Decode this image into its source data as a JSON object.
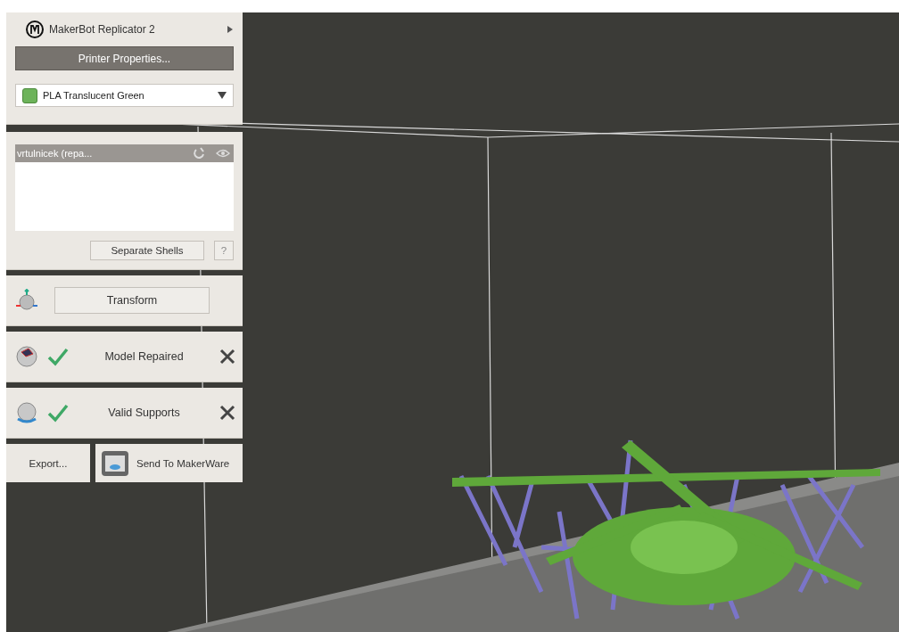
{
  "printer": {
    "name": "MakerBot Replicator 2",
    "properties_button": "Printer Properties..."
  },
  "material": {
    "label": "PLA Translucent Green",
    "color": "#6db35a"
  },
  "objects": {
    "items": [
      {
        "name": "vrtulnicek (repa...",
        "selected": true
      }
    ],
    "separate_button": "Separate Shells",
    "help_button": "?"
  },
  "tools": [
    {
      "kind": "button",
      "label": "Transform"
    },
    {
      "kind": "status",
      "label": "Model Repaired",
      "checked": true
    },
    {
      "kind": "status",
      "label": "Valid Supports",
      "checked": true
    }
  ],
  "export_button": "Export...",
  "send_button": "Send To MakerWare"
}
